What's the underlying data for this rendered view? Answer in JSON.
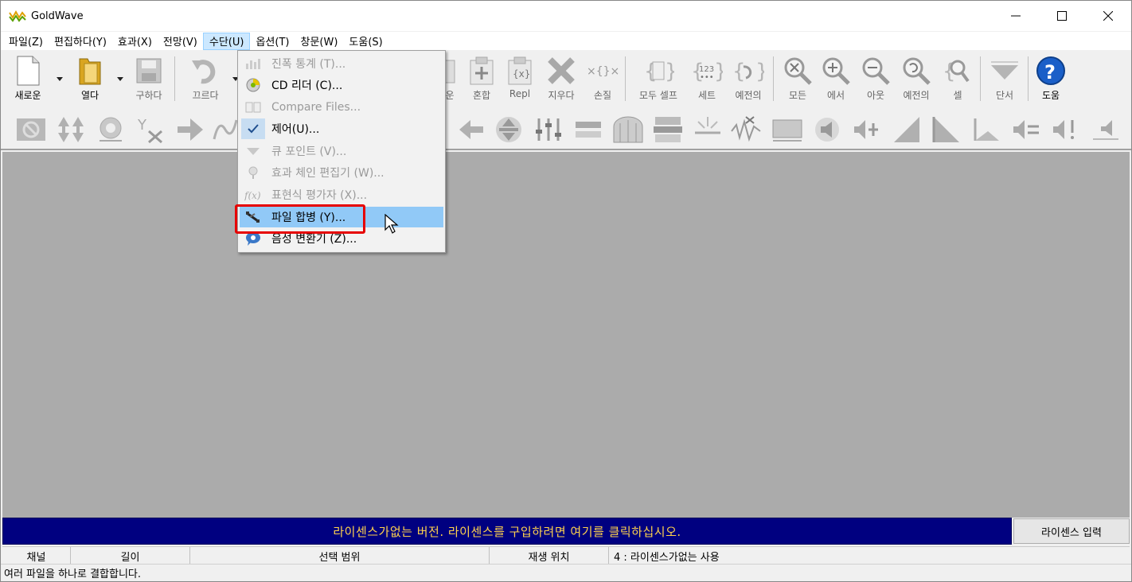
{
  "window": {
    "title": "GoldWave"
  },
  "menu": {
    "items": [
      "파일(Z)",
      "편집하다(Y)",
      "효과(X)",
      "전망(V)",
      "수단(U)",
      "옵션(T)",
      "창문(W)",
      "도움(S)"
    ],
    "active_index": 4
  },
  "toolbar": {
    "new_label": "새로운",
    "open_label": "열다",
    "save_label": "구하다",
    "undo_label": "끄르다",
    "partial1_label": "운",
    "mix_label": "혼합",
    "repl_label": "Repl",
    "delete_label": "지우다",
    "trim_label": "손질",
    "selall_label": "모두 셀프",
    "set_label": "세트",
    "prev_label": "예전의",
    "all_label": "모든",
    "zoomin_label": "에서",
    "zoomout_label": "아웃",
    "zoomprev_label": "예전의",
    "cell_label": "셀",
    "cue_label": "단서",
    "help_label": "도움"
  },
  "dropdown": {
    "items": [
      {
        "label": "진폭 통계 (T)...",
        "icon": "amplitude-stats-icon",
        "disabled": true
      },
      {
        "label": "CD 리더 (C)...",
        "icon": "cd-reader-icon",
        "disabled": false
      },
      {
        "label": "Compare Files...",
        "icon": "compare-files-icon",
        "disabled": true
      },
      {
        "label": "제어(U)...",
        "icon": "check-icon",
        "disabled": false
      },
      {
        "label": "큐 포인트 (V)...",
        "icon": "cue-point-icon",
        "disabled": true
      },
      {
        "label": "효과 체인 편집기 (W)...",
        "icon": "effect-chain-icon",
        "disabled": true
      },
      {
        "label": "표현식 평가자 (X)...",
        "icon": "expression-evaluator-icon",
        "disabled": true
      },
      {
        "label": "파일 합병 (Y)...",
        "icon": "file-merge-icon",
        "disabled": false,
        "highlighted": true
      },
      {
        "label": "음성 변환기 (Z)...",
        "icon": "voice-converter-icon",
        "disabled": false
      }
    ]
  },
  "license": {
    "message": "라이센스가없는 버전. 라이센스를 구입하려면 여기를 클릭하십시오.",
    "button_label": "라이센스 입력"
  },
  "status": {
    "channel": "채널",
    "length": "길이",
    "selection": "선택 범위",
    "playpos": "재생 위치",
    "info": "4 : 라이센스가없는 사용"
  },
  "hint": "여러 파일을 하나로 결합합니다.",
  "colors": {
    "license_bg": "#000080",
    "license_text": "#ffd24d",
    "highlight": "#e60000",
    "menu_hover": "#91c9f7"
  }
}
